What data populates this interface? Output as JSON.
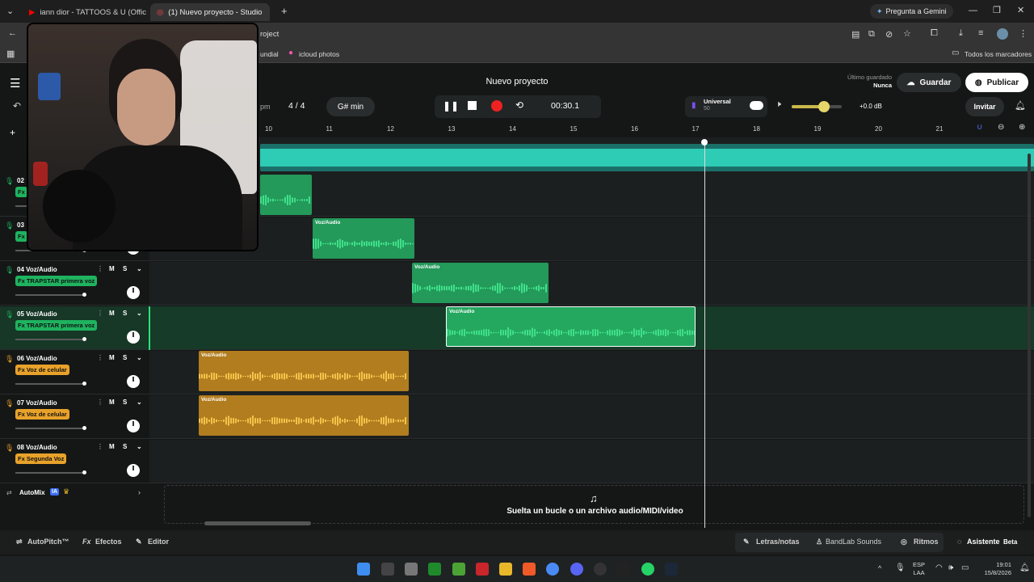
{
  "browser": {
    "tabs": [
      {
        "label": "iann dior - TATTOOS & U (Offic"
      },
      {
        "label": "(1) Nuevo proyecto - Studio"
      }
    ],
    "url_fragment": "roject",
    "ask_gemini": "Pregunta a Gemini",
    "bookmarks": [
      "undial",
      "icloud photos"
    ],
    "all_bookmarks": "Todos los marcadores"
  },
  "app": {
    "project_title": "Nuevo proyecto",
    "last_saved_label": "Último guardado",
    "last_saved_value": "Nunca",
    "save_label": "Guardar",
    "publish_label": "Publicar",
    "invite_label": "Invitar",
    "bpm_suffix": "pm",
    "time_signature": "4 / 4",
    "key": "G# min",
    "time": "00:30.1",
    "tuner_name": "Universal",
    "tuner_value": "50",
    "master_gain": "+0.0 dB",
    "master_volume_level": 0.65,
    "ruler": [
      "10",
      "11",
      "12",
      "13",
      "14",
      "15",
      "16",
      "17",
      "18",
      "19",
      "20",
      "21"
    ],
    "drop_text": "Suelta un bucle o un archivo audio/MIDI/video"
  },
  "tracks": [
    {
      "num": "02",
      "name": "",
      "fx": "Fx",
      "color": "#1fb35f"
    },
    {
      "num": "03",
      "name": "",
      "fx": "Fx",
      "color": "#1fb35f"
    },
    {
      "num": "04",
      "name": "Voz/Audio",
      "fx": "Fx TRAPSTAR primera voz",
      "color": "#1fb35f"
    },
    {
      "num": "05",
      "name": "Voz/Audio",
      "fx": "Fx TRAPSTAR primera voz",
      "color": "#1fb35f"
    },
    {
      "num": "06",
      "name": "Voz/Audio",
      "fx": "Fx Voz de celular",
      "color": "#e8a22a"
    },
    {
      "num": "07",
      "name": "Voz/Audio",
      "fx": "Fx Voz de celular",
      "color": "#e8a22a"
    },
    {
      "num": "08",
      "name": "Voz/Audio",
      "fx": "Fx Segunda Voz",
      "color": "#e8a22a"
    }
  ],
  "track_controls": {
    "mute": "M",
    "solo": "S"
  },
  "clips": {
    "label": "Voz/Audio"
  },
  "automix": {
    "label": "AutoMix",
    "badge": "IA"
  },
  "bottom": {
    "autopitch": "AutoPitch™",
    "effects": "Efectos",
    "editor": "Editor",
    "lyrics": "Letras/notas",
    "sounds": "BandLab Sounds",
    "rhythms": "Ritmos",
    "assistant": "Asistente",
    "beta": "Beta"
  },
  "taskbar": {
    "lang": "ESP",
    "lang2": "LAA",
    "time": "19:01",
    "date": "15/8/2026"
  },
  "colors": {
    "green": "#1fb35f",
    "teal": "#2ecbb5",
    "orange": "#e8a22a",
    "bg": "#151717"
  }
}
